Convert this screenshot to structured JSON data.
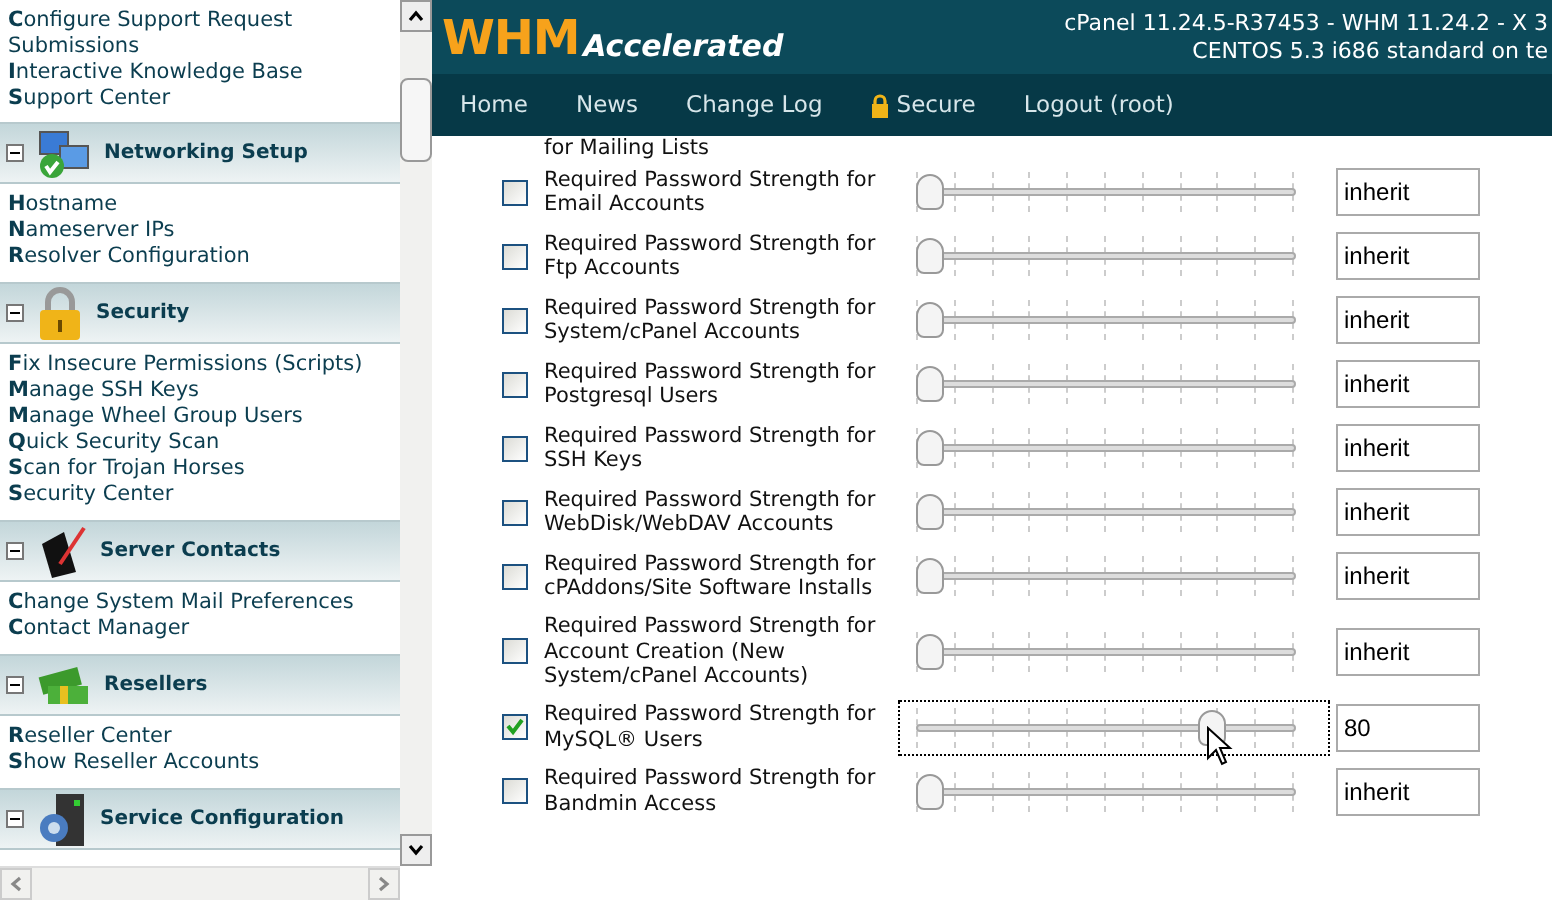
{
  "sidebar": {
    "top_links": [
      "**C**onfigure Support Request Submissions",
      "**I**nteractive Knowledge Base",
      "**S**upport Center"
    ],
    "sections": [
      {
        "title": "Networking Setup",
        "kind": "network",
        "expanded": true,
        "links": [
          "**H**ostname",
          "**N**ameserver IPs",
          "**R**esolver Configuration"
        ]
      },
      {
        "title": "Security",
        "kind": "lock",
        "expanded": true,
        "links": [
          "**F**ix Insecure Permissions (Scripts)",
          "**M**anage SSH Keys",
          "**M**anage Wheel Group Users",
          "**Q**uick Security Scan",
          "**S**can for Trojan Horses",
          "**S**ecurity Center"
        ]
      },
      {
        "title": "Server Contacts",
        "kind": "contacts",
        "expanded": true,
        "links": [
          "**C**hange System Mail Preferences",
          "**C**ontact Manager"
        ]
      },
      {
        "title": "Resellers",
        "kind": "money",
        "expanded": true,
        "links": [
          "**R**eseller Center",
          "**S**how Reseller Accounts"
        ]
      },
      {
        "title": "Service Configuration",
        "kind": "server",
        "expanded": true
      }
    ]
  },
  "header": {
    "logo_main": "WHM",
    "logo_sub": "Accelerated",
    "version_line": "cPanel 11.24.5-R37453 - WHM 11.24.2 - X 3",
    "system_line": "CENTOS 5.3 i686 standard on te"
  },
  "nav": [
    {
      "label": "Home",
      "kind": "plain"
    },
    {
      "label": "News",
      "kind": "plain"
    },
    {
      "label": "Change Log",
      "kind": "plain"
    },
    {
      "label": "Secure",
      "kind": "lock"
    },
    {
      "label": "Logout (root)",
      "kind": "plain"
    }
  ],
  "cut_label": "for Mailing Lists",
  "settings": [
    {
      "label": "Required Password Strength for Email Accounts",
      "checked": false,
      "level": 0,
      "value": "inherit",
      "focused": false
    },
    {
      "label": "Required Password Strength for Ftp Accounts",
      "checked": false,
      "level": 0,
      "value": "inherit",
      "focused": false
    },
    {
      "label": "Required Password Strength for System/cPanel Accounts",
      "checked": false,
      "level": 0,
      "value": "inherit",
      "focused": false
    },
    {
      "label": "Required Password Strength for Postgresql Users",
      "checked": false,
      "level": 0,
      "value": "inherit",
      "focused": false
    },
    {
      "label": "Required Password Strength for SSH Keys",
      "checked": false,
      "level": 0,
      "value": "inherit",
      "focused": false
    },
    {
      "label": "Required Password Strength for WebDisk/WebDAV Accounts",
      "checked": false,
      "level": 0,
      "value": "inherit",
      "focused": false
    },
    {
      "label": "Required Password Strength for cPAddons/Site Software Installs",
      "checked": false,
      "level": 0,
      "value": "inherit",
      "focused": false
    },
    {
      "label": "Required Password Strength for Account Creation (New System/cPanel Accounts)",
      "checked": false,
      "level": 0,
      "value": "inherit",
      "focused": false
    },
    {
      "label": "Required Password Strength for MySQL® Users",
      "checked": true,
      "level": 0.8,
      "value": "80",
      "focused": true
    },
    {
      "label": "Required Password Strength for Bandmin Access",
      "checked": false,
      "level": 0,
      "value": "inherit",
      "focused": false
    }
  ]
}
